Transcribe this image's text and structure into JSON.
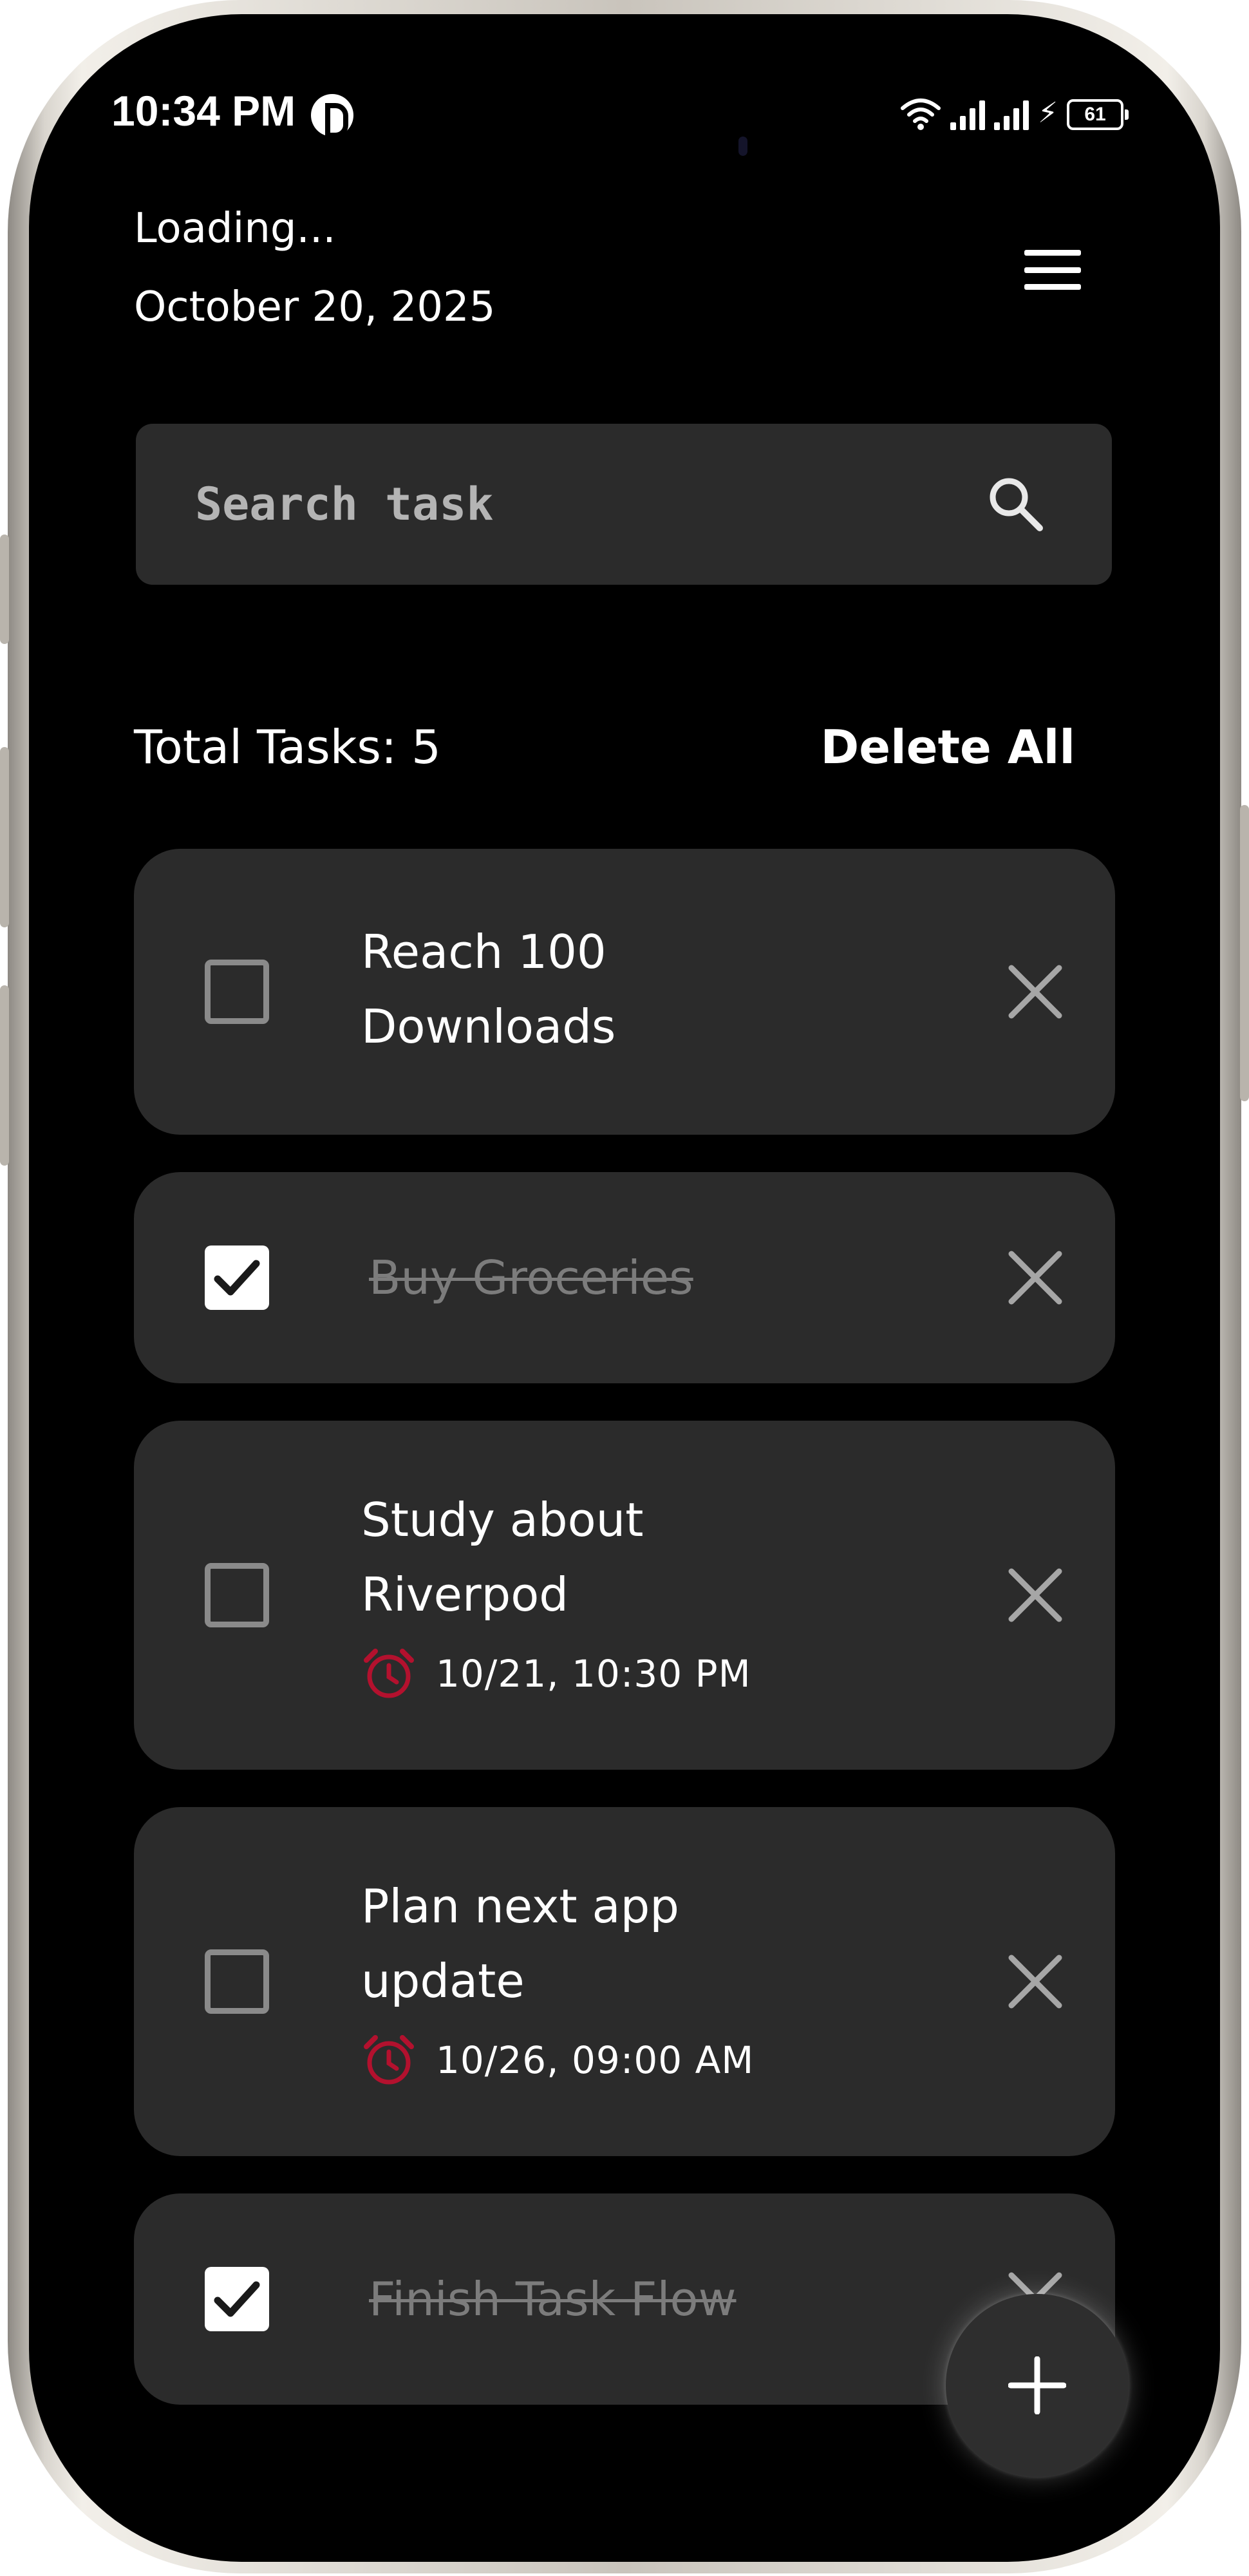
{
  "status_bar": {
    "time": "10:34 PM",
    "battery": "61",
    "bolt": "⚡"
  },
  "header": {
    "line1": "Loading...",
    "line2": "October 20, 2025"
  },
  "search": {
    "placeholder": "Search task"
  },
  "summary": {
    "total_label": "Total Tasks: 5",
    "delete_all_label": "Delete All"
  },
  "tasks": [
    {
      "title": "Reach 100 Downloads",
      "completed": false,
      "reminder": ""
    },
    {
      "title": "Buy Groceries",
      "completed": true,
      "reminder": ""
    },
    {
      "title": "Study about Riverpod",
      "completed": false,
      "reminder": "10/21, 10:30 PM"
    },
    {
      "title": "Plan next app update",
      "completed": false,
      "reminder": "10/26, 09:00 AM"
    },
    {
      "title": "Finish Task Flow",
      "completed": true,
      "reminder": ""
    }
  ],
  "colors": {
    "background": "#000000",
    "card": "#2b2b2b",
    "alarm_accent": "#b3112e",
    "completed_text": "#7c7c7c"
  },
  "icons": {
    "menu": "hamburger-menu-icon",
    "search": "search-icon",
    "alarm": "alarm-clock-icon",
    "close": "close-icon",
    "check": "check-icon",
    "add": "plus-icon"
  }
}
